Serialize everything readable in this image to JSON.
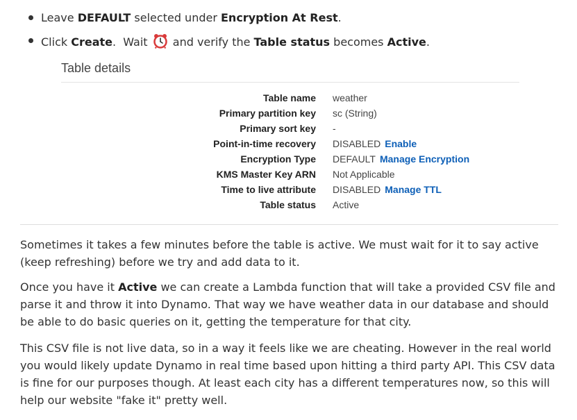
{
  "bullets": [
    {
      "pre": "Leave ",
      "b1": "DEFAULT",
      "mid": " selected under ",
      "b2": "Encryption At Rest",
      "post": "."
    },
    {
      "pre": "Click ",
      "b1": "Create",
      "mid1": ".  Wait ",
      "icon": "alarm-clock-icon",
      "mid2": " and verify the ",
      "b2": "Table status",
      "mid3": " becomes ",
      "b3": "Active",
      "post": "."
    }
  ],
  "table_details": {
    "title": "Table details",
    "rows": [
      {
        "key": "Table name",
        "value": "weather"
      },
      {
        "key": "Primary partition key",
        "value": "sc (String)"
      },
      {
        "key": "Primary sort key",
        "value": "-"
      },
      {
        "key": "Point-in-time recovery",
        "value": "DISABLED",
        "link": "Enable"
      },
      {
        "key": "Encryption Type",
        "value": "DEFAULT",
        "link": "Manage Encryption"
      },
      {
        "key": "KMS Master Key ARN",
        "value": "Not Applicable"
      },
      {
        "key": "Time to live attribute",
        "value": "DISABLED",
        "link": "Manage TTL"
      },
      {
        "key": "Table status",
        "value": "Active"
      }
    ]
  },
  "paragraphs": {
    "p1": "Sometimes it takes a few minutes before the table is active. We must wait for it to say active (keep refreshing) before we try and add data to it.",
    "p2_pre": "Once you have it ",
    "p2_bold": "Active",
    "p2_post": " we can create a Lambda function that will take a provided CSV file and parse it and throw it into Dynamo. That way we have weather data in our database and should be able to do basic queries on it, getting the temperature for that city.",
    "p3": "This CSV file is not live data, so in a way it feels like we are cheating. However in the real world you would likely update Dynamo in real time based upon hitting a third party API. This CSV data is fine for our purposes though.  At least each city has a different temperatures now, so this will help our website \"fake it\" pretty well."
  },
  "colors": {
    "link": "#0d5fb7",
    "clock_red": "#d93a3a"
  }
}
